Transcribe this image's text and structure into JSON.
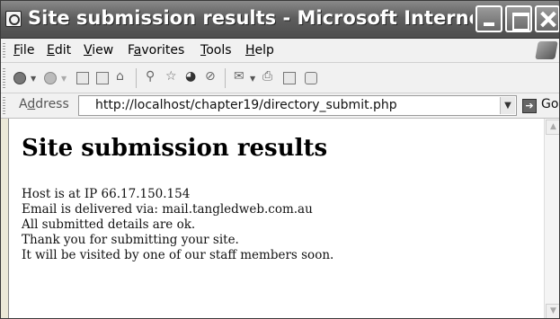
{
  "window": {
    "title": "Site submission results - Microsoft Internet..."
  },
  "menu": {
    "items": [
      {
        "accel": "F",
        "rest": "ile"
      },
      {
        "accel": "E",
        "rest": "dit"
      },
      {
        "accel": "V",
        "rest": "iew"
      },
      {
        "pre": "F",
        "accel": "a",
        "rest": "vorites"
      },
      {
        "accel": "T",
        "rest": "ools"
      },
      {
        "accel": "H",
        "rest": "elp"
      }
    ]
  },
  "toolbar": {
    "icons": [
      "back-icon",
      "forward-icon",
      "stop-icon",
      "refresh-icon",
      "home-icon",
      "search-icon",
      "favorites-icon",
      "media-icon",
      "history-icon",
      "mail-icon",
      "print-icon",
      "edit-icon",
      "discuss-icon"
    ]
  },
  "address": {
    "label_pre": "A",
    "label_accel": "d",
    "label_rest": "dress",
    "url": "http://localhost/chapter19/directory_submit.php",
    "go_label": "Go"
  },
  "page": {
    "heading": "Site submission results",
    "lines": [
      "Host is at IP 66.17.150.154",
      "Email is delivered via: mail.tangledweb.com.au",
      "All submitted details are ok.",
      "Thank you for submitting your site.",
      "It will be visited by one of our staff members soon."
    ]
  }
}
